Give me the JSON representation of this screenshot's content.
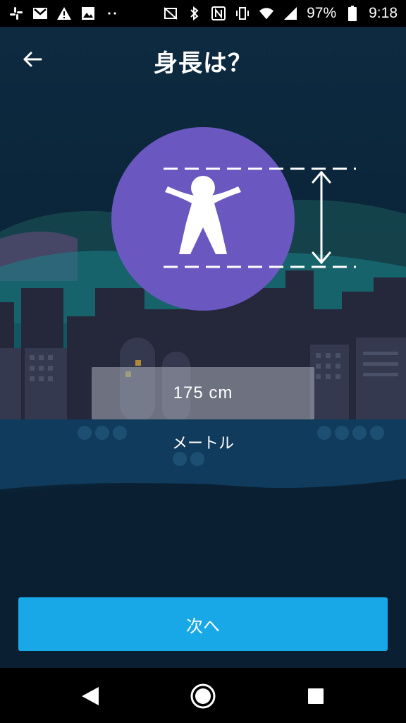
{
  "status_bar": {
    "battery_percent": "97%",
    "time": "9:18",
    "left_icons": [
      "slack-icon",
      "gmail-icon",
      "warning-icon",
      "image-icon",
      "more-dots-icon"
    ],
    "right_icons": [
      "no-sim-icon",
      "bluetooth-icon",
      "nfc-icon",
      "vibrate-icon",
      "wifi-icon",
      "signal-icon",
      "battery-icon"
    ]
  },
  "header": {
    "title": "身長は？",
    "back_icon": "arrow-left-icon"
  },
  "hero": {
    "icon": "person-height-icon",
    "accent_color": "#6a57c0"
  },
  "height_input": {
    "value": "175  cm"
  },
  "unit_toggle": {
    "label": "メートル"
  },
  "next_button": {
    "label": "次へ",
    "color": "#18a8e8"
  },
  "nav_bar": {
    "back_icon": "nav-back-icon",
    "home_icon": "nav-home-icon",
    "recents_icon": "nav-recents-icon"
  }
}
